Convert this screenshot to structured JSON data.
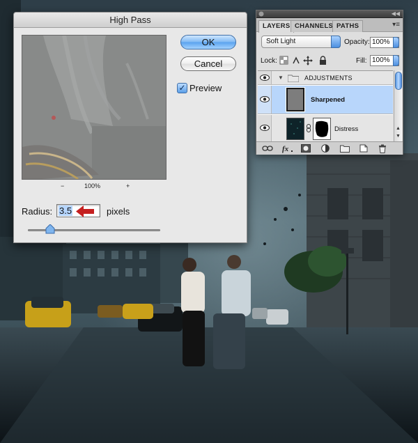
{
  "high_pass": {
    "title": "High Pass",
    "ok_label": "OK",
    "cancel_label": "Cancel",
    "preview_label": "Preview",
    "preview_checked": true,
    "zoom_out": "−",
    "zoom_level": "100%",
    "zoom_in": "+",
    "radius_label": "Radius:",
    "radius_value": "3.5",
    "radius_unit": "pixels"
  },
  "layers_panel": {
    "tabs": [
      "LAYERS",
      "CHANNELS",
      "PATHS"
    ],
    "blend_mode": "Soft Light",
    "opacity_label": "Opacity:",
    "opacity_value": "100%",
    "lock_label": "Lock:",
    "fill_label": "Fill:",
    "fill_value": "100%",
    "layers": [
      {
        "name": "ADJUSTMENTS",
        "type": "group"
      },
      {
        "name": "Sharpened",
        "type": "layer",
        "selected": true
      },
      {
        "name": "Distress",
        "type": "layer-with-mask"
      }
    ],
    "footer_icons": [
      "link-layers-icon",
      "fx-icon",
      "add-mask-icon",
      "adjustment-layer-icon",
      "new-group-icon",
      "new-layer-icon",
      "trash-icon"
    ]
  },
  "colors": {
    "accent_blue": "#5aa2ee",
    "selected_row": "#b8d6fb",
    "arrow_red": "#c41f1f"
  }
}
